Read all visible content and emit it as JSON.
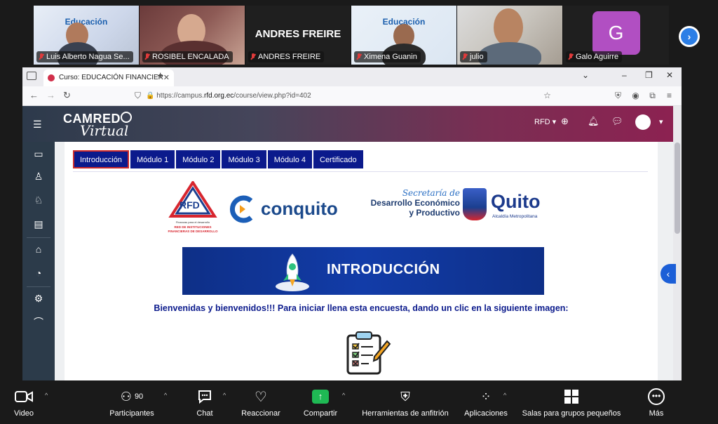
{
  "participants": [
    {
      "name": "Luis Alberto Nagua Se...",
      "muted": true,
      "bg_text": "Educación"
    },
    {
      "name": "ROSIBEL ENCALADA",
      "muted": true
    },
    {
      "name": "ANDRES FREIRE",
      "muted": true,
      "display_name": "ANDRES FREIRE"
    },
    {
      "name": "Ximena Guanin",
      "muted": true,
      "bg_text": "Educación"
    },
    {
      "name": "julio",
      "muted": true
    },
    {
      "name": "Galo Aguirre",
      "muted": true,
      "avatar_letter": "G"
    }
  ],
  "browser": {
    "tab_title": "Curso: EDUCACIÓN FINANCIER",
    "url_prefix": "https://campus.",
    "url_domain": "rfd.org.ec",
    "url_suffix": "/course/view.php?id=402"
  },
  "moodle": {
    "logo_top": "CAMRED",
    "logo_bottom": "Virtual",
    "lang": "RFD ▾",
    "course_tabs": [
      "Introducción",
      "Módulo 1",
      "Módulo 2",
      "Módulo 3",
      "Módulo 4",
      "Certificado"
    ],
    "active_tab": 0,
    "logos": {
      "rfd": "RFD",
      "rfd_tag1": "Finanzas para el desarrollo",
      "rfd_tag2": "RED DE INSTITUCIONES",
      "rfd_tag3": "FINANCIERAS DE DESARROLLO",
      "conquito": "conquito",
      "secretaria": "Secretaría de",
      "desarrollo": "Desarrollo Económico",
      "productivo": "y Productivo",
      "quito": "Quito",
      "alcaldia": "Alcaldía Metropolitana"
    },
    "banner_title": "INTRODUCCIÓN",
    "welcome_text": "Bienvenidas y bienvenidos!!! Para iniciar  llena esta encuesta, dando un clic en la siguiente imagen:"
  },
  "zoom_toolbar": {
    "video": "Video",
    "participants": "Participantes",
    "participants_count": "90",
    "chat": "Chat",
    "react": "Reaccionar",
    "share": "Compartir",
    "host_tools": "Herramientas de anfitrión",
    "apps": "Aplicaciones",
    "breakout": "Salas para grupos pequeños",
    "more": "Más"
  },
  "colors": {
    "course_tab": "#0b1a8c",
    "active_border": "#cc2a2a",
    "zoom_blue": "#2d7fe6",
    "share_green": "#1fb954",
    "galo_avatar": "#b14fc2"
  }
}
